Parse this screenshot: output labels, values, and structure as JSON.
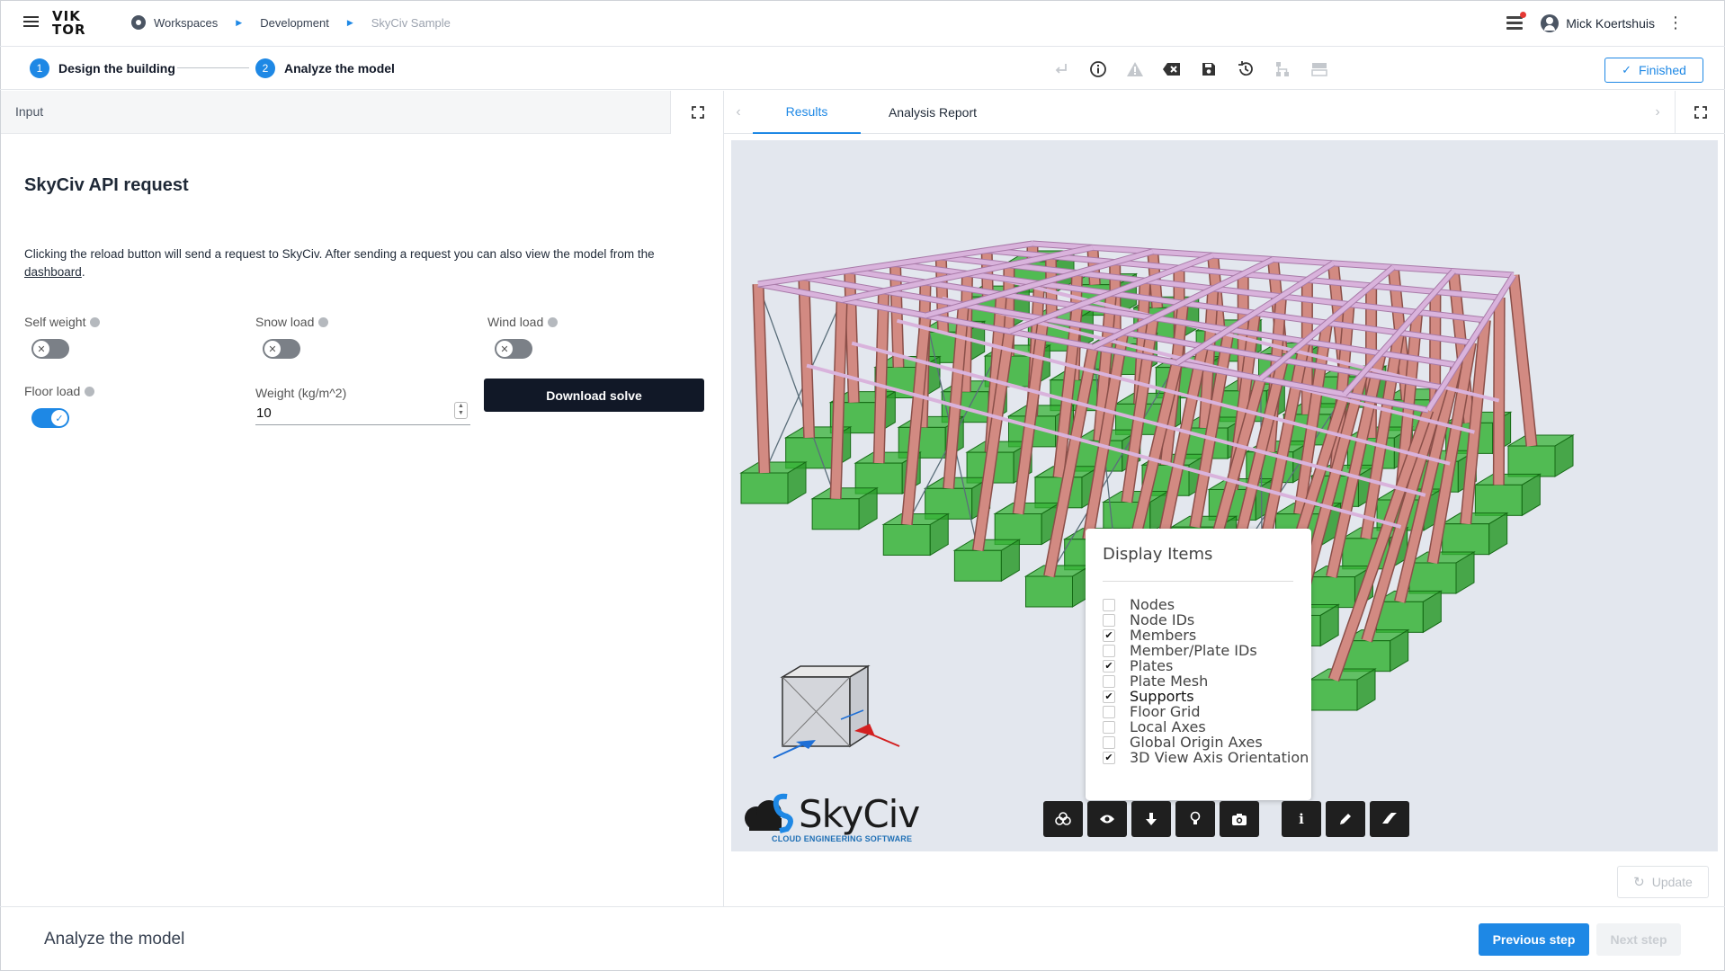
{
  "app": {
    "logo_line1": "VIK",
    "logo_line2": "TOR"
  },
  "breadcrumb": [
    {
      "label": "Workspaces"
    },
    {
      "label": "Development"
    },
    {
      "label": "SkyCiv Sample"
    }
  ],
  "user": {
    "name": "Mick Koertshuis"
  },
  "steps": [
    {
      "number": "1",
      "label": "Design the building"
    },
    {
      "number": "2",
      "label": "Analyze the model"
    }
  ],
  "toolbar": {
    "icons": [
      "enter-icon",
      "info-icon",
      "warning-icon",
      "clear-icon",
      "save-icon",
      "history-icon",
      "hierarchy-icon",
      "layout-icon"
    ],
    "finished_label": "Finished"
  },
  "input_panel": {
    "header": "Input",
    "title": "SkyCiv API request",
    "description": "Clicking the reload button will send a request to SkyCiv. After sending a request you can also view the model from the",
    "description_link": "dashboard",
    "description_end": ".",
    "toggles": [
      {
        "label": "Self weight",
        "on": false
      },
      {
        "label": "Snow load",
        "on": false
      },
      {
        "label": "Wind load",
        "on": false
      },
      {
        "label": "Floor load",
        "on": true
      }
    ],
    "weight_label": "Weight (kg/m^2)",
    "weight_value": "10",
    "download_label": "Download solve"
  },
  "output_panel": {
    "tabs": [
      {
        "label": "Results",
        "active": true
      },
      {
        "label": "Analysis Report",
        "active": false
      }
    ],
    "display_items": {
      "title": "Display Items",
      "items": [
        {
          "label": "Nodes",
          "checked": false
        },
        {
          "label": "Node IDs",
          "checked": false
        },
        {
          "label": "Members",
          "checked": true
        },
        {
          "label": "Member/Plate IDs",
          "checked": false
        },
        {
          "label": "Plates",
          "checked": true
        },
        {
          "label": "Plate Mesh",
          "checked": false
        },
        {
          "label": "Supports",
          "checked": true
        },
        {
          "label": "Floor Grid",
          "checked": false
        },
        {
          "label": "Local Axes",
          "checked": false
        },
        {
          "label": "Global Origin Axes",
          "checked": false
        },
        {
          "label": "3D View Axis Orientation",
          "checked": true
        }
      ]
    },
    "viewer_tools": [
      "layers-icon",
      "eye-icon",
      "download-icon",
      "bulb-icon",
      "camera-icon",
      "info-icon",
      "pencil-icon",
      "eraser-icon"
    ],
    "skyciv_brand": "SkyCiv",
    "skyciv_tagline": "CLOUD ENGINEERING SOFTWARE",
    "update_label": "Update"
  },
  "footer": {
    "title": "Analyze the model",
    "previous_label": "Previous step",
    "next_label": "Next step"
  },
  "colors": {
    "accent": "#1e88e5",
    "column": "#d28a82",
    "beam": "#d9b3dc",
    "support": "#37b337",
    "brace": "#5a6e7a"
  }
}
